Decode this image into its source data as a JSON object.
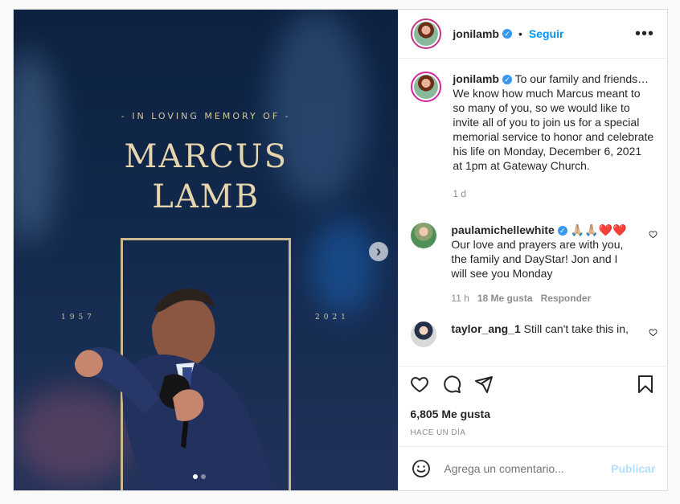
{
  "post": {
    "image": {
      "memory_text": "- IN LOVING MEMORY OF -",
      "name_line_1": "MARCUS",
      "name_line_2": "LAMB",
      "year_start": "1957",
      "year_end": "2021"
    },
    "header": {
      "username": "jonilamb",
      "verified": true,
      "follow_label": "Seguir",
      "more_icon": "more-options-icon"
    },
    "caption": {
      "username": "jonilamb",
      "text": "To our family and friends… We know how much Marcus meant to so many of you, so we would like to invite all of you to join us for a special memorial service to honor and celebrate his life on Monday, December 6, 2021 at 1pm at Gateway Church.",
      "time": "1 d"
    },
    "comments": [
      {
        "username": "paulamichellewhite",
        "text": "🙏🏼🙏🏼❤️❤️ Our love and prayers are with you, the family and DayStar! Jon and I will see you Monday",
        "time": "11 h",
        "likes": "18 Me gusta",
        "reply": "Responder"
      },
      {
        "username": "taylor_ang_1",
        "text": "Still can't take this in,"
      }
    ],
    "actions": {
      "likes": "6,805 Me gusta",
      "time": "HACE UN DÍA"
    },
    "comment_bar": {
      "placeholder": "Agrega un comentario...",
      "publish": "Publicar"
    },
    "colors": {
      "accent_blue": "#0095f6",
      "verified_blue": "#3897f0",
      "muted": "#8e8e8e",
      "gold_text": "#e7d6ad"
    }
  }
}
